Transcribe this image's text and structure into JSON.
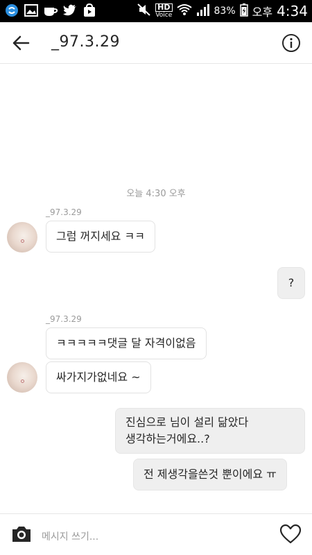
{
  "status_bar": {
    "battery_percent": "83%",
    "am_pm": "오후",
    "time": "4:34",
    "hd_label": "HD",
    "voice_label": "Voice"
  },
  "header": {
    "title": "_97.3.29"
  },
  "chat": {
    "timestamp": "오늘 4:30 오후",
    "group1": {
      "sender": "_97.3.29",
      "messages": [
        "그럼 꺼지세요 ㅋㅋ"
      ]
    },
    "outgoing1": "?",
    "group2": {
      "sender": "_97.3.29",
      "messages": [
        "ㅋㅋㅋㅋㅋ댓글 달 자격이없음",
        "싸가지가없네요 ~"
      ]
    },
    "outgoing2": {
      "line1": "진심으로 님이 설리 닮았다",
      "line2": "생각하는거에요..?"
    },
    "outgoing3": "전 제생각을쓴것 뿐이에요 ㅠ"
  },
  "composer": {
    "placeholder": "메시지 쓰기..."
  }
}
